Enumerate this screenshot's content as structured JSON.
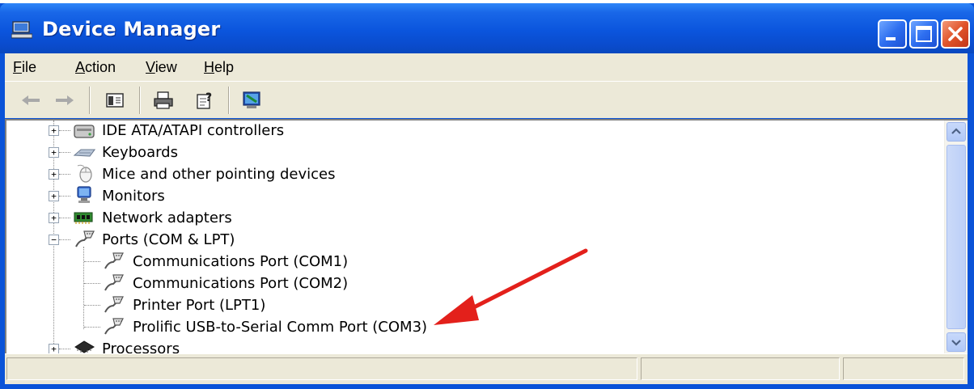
{
  "window": {
    "title": "Device Manager"
  },
  "menu": [
    {
      "label": "File",
      "underline": "F",
      "rest": "ile"
    },
    {
      "label": "Action",
      "underline": "A",
      "rest": "ction"
    },
    {
      "label": "View",
      "underline": "V",
      "rest": "iew"
    },
    {
      "label": "Help",
      "underline": "H",
      "rest": "elp"
    }
  ],
  "toolbar": {
    "back_icon": "back-arrow-icon",
    "forward_icon": "forward-arrow-icon",
    "show_hide_icon": "show-hide-console-tree-icon",
    "print_icon": "printer-icon",
    "help_icon": "help-properties-icon",
    "scan_icon": "scan-hardware-icon"
  },
  "tree": {
    "categories": [
      {
        "label": "IDE ATA/ATAPI controllers",
        "expanded": false,
        "icon": "ide-controller-icon"
      },
      {
        "label": "Keyboards",
        "expanded": false,
        "icon": "keyboard-icon"
      },
      {
        "label": "Mice and other pointing devices",
        "expanded": false,
        "icon": "mouse-icon"
      },
      {
        "label": "Monitors",
        "expanded": false,
        "icon": "monitor-icon"
      },
      {
        "label": "Network adapters",
        "expanded": false,
        "icon": "network-adapter-icon"
      },
      {
        "label": "Ports (COM & LPT)",
        "expanded": true,
        "icon": "port-icon",
        "children": [
          {
            "label": "Communications Port (COM1)",
            "icon": "port-icon"
          },
          {
            "label": "Communications Port (COM2)",
            "icon": "port-icon"
          },
          {
            "label": "Printer Port (LPT1)",
            "icon": "port-icon"
          },
          {
            "label": "Prolific USB-to-Serial Comm Port (COM3)",
            "icon": "port-icon"
          }
        ]
      },
      {
        "label": "Processors",
        "expanded": false,
        "icon": "processor-icon"
      }
    ]
  },
  "annotation": {
    "color": "#e3201b",
    "target": "Prolific USB-to-Serial Comm Port (COM3)"
  },
  "status": {
    "cells": [
      "",
      "",
      ""
    ]
  }
}
